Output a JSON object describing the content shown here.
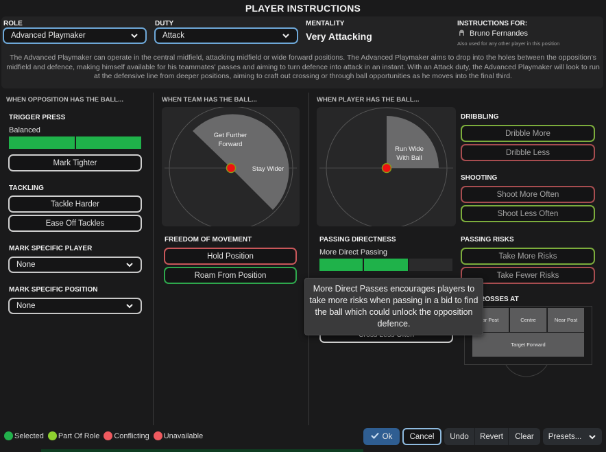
{
  "title": "PLAYER INSTRUCTIONS",
  "header": {
    "role_label": "ROLE",
    "role_value": "Advanced Playmaker",
    "duty_label": "DUTY",
    "duty_value": "Attack",
    "mentality_label": "MENTALITY",
    "mentality_value": "Very Attacking",
    "instructions_for_label": "INSTRUCTIONS FOR:",
    "player_name": "Bruno Fernandes",
    "player_note": "Also used for any other player in this position",
    "description": "The Advanced Playmaker can operate in the central midfield, attacking midfield or wide forward positions. The Advanced Playmaker aims to drop into the holes between the opposition's midfield and defence, making himself available for his teammates' passes and aiming to turn defence into attack in an instant. With an Attack duty, the Advanced Playmaker will look to run at the defensive line from deeper positions, aiming to craft out crossing or through ball opportunities as he moves into the final third."
  },
  "opposition_col": {
    "title": "WHEN OPPOSITION HAS THE BALL...",
    "trigger_press": {
      "label": "TRIGGER PRESS",
      "value_text": "Balanced",
      "level": 2,
      "max": 2
    },
    "mark_tighter": "Mark Tighter",
    "tackling_label": "TACKLING",
    "tackle_harder": "Tackle Harder",
    "ease_off_tackles": "Ease Off Tackles",
    "mark_player_label": "MARK SPECIFIC PLAYER",
    "mark_player_value": "None",
    "mark_position_label": "MARK SPECIFIC POSITION",
    "mark_position_value": "None"
  },
  "team_col": {
    "title": "WHEN TEAM HAS THE BALL...",
    "pitch_label_forward": "Get Further Forward",
    "pitch_label_forward_line1": "Get Further",
    "pitch_label_forward_line2": "Forward",
    "pitch_label_wider": "Stay Wider",
    "freedom_label": "FREEDOM OF MOVEMENT",
    "hold_position": "Hold Position",
    "roam_from_position": "Roam From Position"
  },
  "player_col": {
    "title": "WHEN PLAYER HAS THE BALL...",
    "pitch_label_line1": "Run Wide",
    "pitch_label_line2": "With Ball",
    "passing_directness_label": "PASSING DIRECTNESS",
    "passing_directness_value": "More Direct Passing",
    "passing_directness_level": 2,
    "passing_directness_max": 3,
    "cross_less_often": "Cross Less Often"
  },
  "right_col": {
    "dribbling_label": "DRIBBLING",
    "dribble_more": "Dribble More",
    "dribble_less": "Dribble Less",
    "shooting_label": "SHOOTING",
    "shoot_more": "Shoot More Often",
    "shoot_less": "Shoot Less Often",
    "passing_risks_label": "PASSING RISKS",
    "take_more_risks": "Take More Risks",
    "take_fewer_risks": "Take Fewer Risks",
    "crosses_at_label": "CROSSES AT",
    "crosses_at_visible": "ROSSES AT",
    "far_post": "ar Post",
    "centre": "Centre",
    "near_post": "Near Post",
    "target_forward": "Target Forward"
  },
  "tooltip": "More Direct Passes encourages players to take more risks when passing in a bid to find the ball which could unlock the opposition defence.",
  "legend": [
    {
      "label": "Selected",
      "color": "#22b14c"
    },
    {
      "label": "Part Of Role",
      "color": "#8fd130"
    },
    {
      "label": "Conflicting",
      "color": "#ef5a5f"
    },
    {
      "label": "Unavailable",
      "color": "#ef5a5f"
    }
  ],
  "footer": {
    "ok": "Ok",
    "cancel": "Cancel",
    "undo": "Undo",
    "revert": "Revert",
    "clear": "Clear",
    "presets": "Presets..."
  },
  "colors": {
    "selected": "#22b14c",
    "part_of_role": "#8fd130",
    "conflicting": "#ef5a5f",
    "accent_blue": "#6ea8d8"
  }
}
